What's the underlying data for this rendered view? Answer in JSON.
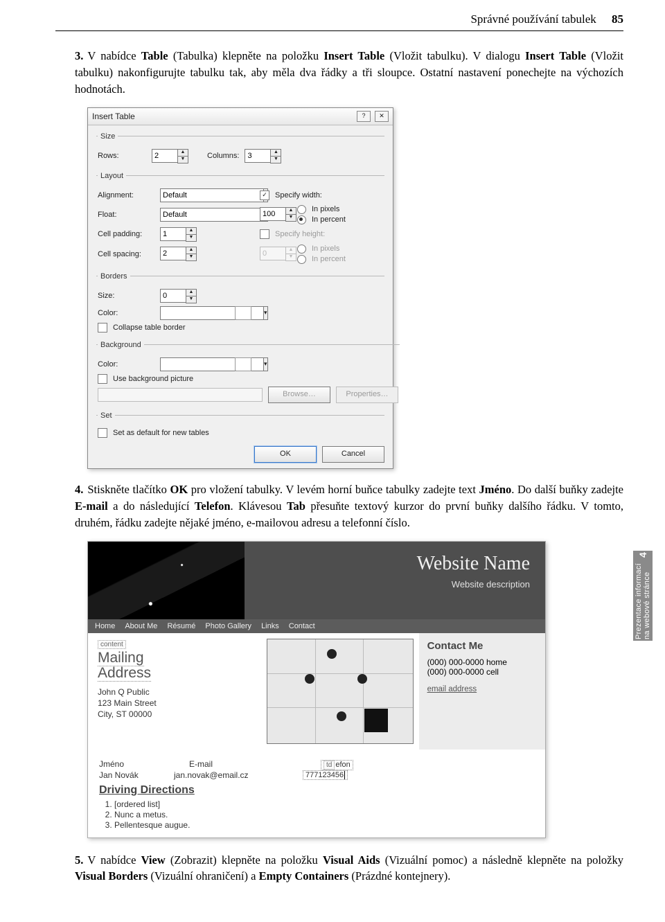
{
  "header": {
    "title": "Správné používání tabulek",
    "page": "85"
  },
  "step3": {
    "num": "3.",
    "text_before_bold1": "V nabídce ",
    "b1": "Table",
    "t2": " (Tabulka) klepněte na položku ",
    "b2": "Insert Table",
    "t3": " (Vložit tabulku). V dialogu ",
    "b3": "Insert Table",
    "t4": " (Vložit tabulku) nakonfigurujte tabulku tak, aby měla dva řádky a tři sloupce. Ostatní nastavení ponechejte na výchozích hodnotách."
  },
  "dialog": {
    "title": "Insert Table",
    "help_btn": "?",
    "close_btn": "✕",
    "groups": {
      "size": "Size",
      "layout": "Layout",
      "borders": "Borders",
      "background": "Background",
      "set": "Set"
    },
    "size": {
      "rows_label": "Rows:",
      "rows_value": "2",
      "cols_label": "Columns:",
      "cols_value": "3"
    },
    "layout": {
      "alignment_label": "Alignment:",
      "alignment_value": "Default",
      "float_label": "Float:",
      "float_value": "Default",
      "specify_width_label": "Specify width:",
      "specify_width_checked": true,
      "width_value": "100",
      "pixels_label": "In pixels",
      "percent_label": "In percent",
      "percent_checked": true,
      "cell_padding_label": "Cell padding:",
      "cell_padding_value": "1",
      "specify_height_label": "Specify height:",
      "specify_height_checked": false,
      "height_value": "0",
      "h_pixels_label": "In pixels",
      "h_percent_label": "In percent",
      "cell_spacing_label": "Cell spacing:",
      "cell_spacing_value": "2"
    },
    "borders": {
      "size_label": "Size:",
      "size_value": "0",
      "color_label": "Color:",
      "collapse_label": "Collapse table border"
    },
    "background": {
      "color_label": "Color:",
      "usepic_label": "Use background picture",
      "browse_btn": "Browse…",
      "properties_btn": "Properties…"
    },
    "set": {
      "default_label": "Set as default for new tables"
    },
    "buttons": {
      "ok": "OK",
      "cancel": "Cancel"
    }
  },
  "step4": {
    "num": "4.",
    "t1": "Stiskněte tlačítko ",
    "b1": "OK",
    "t2": " pro vložení tabulky. V levém horní buňce tabulky zadejte text ",
    "b2": "Jméno",
    "t3": ". Do další buňky zadejte ",
    "b3": "E-mail",
    "t4": " a do následující ",
    "b4": "Telefon",
    "t5": ". Klávesou ",
    "b5": "Tab",
    "t6": " přesuňte textový kurzor do první buňky dalšího řádku. V tomto, druhém, řádku zadejte nějaké jméno, e-mailovou adresu a telefonní číslo."
  },
  "sidetab": {
    "line1": "Prezentace informací",
    "line2": "na webové stránce",
    "num": "4"
  },
  "web": {
    "site_name": "Website Name",
    "site_desc": "Website description",
    "nav": [
      "Home",
      "About Me",
      "Résumé",
      "Photo Gallery",
      "Links",
      "Contact"
    ],
    "content_tag": "content",
    "mailing_h1": "Mailing",
    "mailing_h2": "Address",
    "addr1": "John Q Public",
    "addr2": "123 Main Street",
    "addr3": "City, ST 00000",
    "contact_h": "Contact Me",
    "contact_home": "(000) 000-0000 home",
    "contact_cell": "(000) 000-0000 cell",
    "contact_email": "email address",
    "tbl_h1": "Jméno",
    "tbl_h2": "E-mail",
    "tbl_h3_tag": "td",
    "tbl_h3": "efon",
    "row_name": "Jan Novák",
    "row_email": "jan.novak@email.cz",
    "row_tel": "777123456",
    "dd": "Driving Directions",
    "ol1": "[ordered list]",
    "ol2": "Nunc a metus.",
    "ol3": "Pellentesque augue."
  },
  "step5": {
    "num": "5.",
    "t1": "V nabídce ",
    "b1": "View",
    "t2": " (Zobrazit) klepněte na položku ",
    "b2": "Visual Aids",
    "t3": " (Vizuální pomoc) a následně klepněte na položky ",
    "b3": "Visual Borders",
    "t4": " (Vizuální ohraničení) a ",
    "b4": "Empty Containers",
    "t5": " (Prázdné kontejnery)."
  }
}
